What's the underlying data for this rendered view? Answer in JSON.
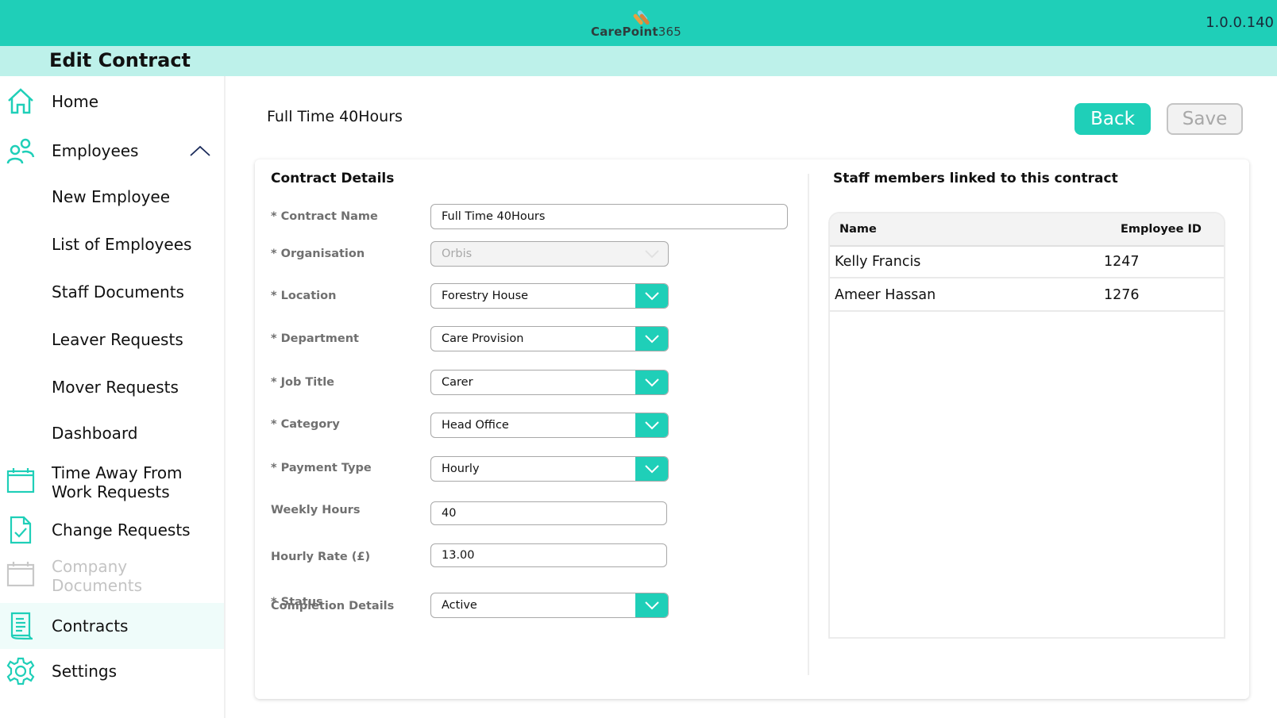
{
  "app": {
    "logo_text_bold": "CarePoint",
    "logo_text_num": "365",
    "version": "1.0.0.140",
    "page_title": "Edit Contract",
    "brand_color": "#1fcfb8"
  },
  "sidebar": {
    "items": [
      {
        "label": "Home",
        "icon": "home-icon"
      },
      {
        "label": "Employees",
        "icon": "users-icon",
        "expanded": true
      },
      {
        "label": "New Employee"
      },
      {
        "label": "List of Employees"
      },
      {
        "label": "Staff Documents"
      },
      {
        "label": "Leaver Requests"
      },
      {
        "label": "Mover Requests"
      },
      {
        "label": "Dashboard"
      },
      {
        "label": "Time Away From",
        "label2": "Work Requests",
        "icon": "calendar-icon"
      },
      {
        "label": "Change Requests",
        "icon": "document-check-icon"
      },
      {
        "label": "Company",
        "label2": "Documents",
        "icon": "calendar-icon",
        "disabled": true
      },
      {
        "label": "Contracts",
        "icon": "contract-icon",
        "active": true
      },
      {
        "label": "Settings",
        "icon": "gear-icon"
      }
    ]
  },
  "header": {
    "contract_title": "Full Time 40Hours",
    "back_label": "Back",
    "save_label": "Save"
  },
  "contract_details": {
    "title": "Contract Details",
    "fields": {
      "contract_name": {
        "label": "* Contract Name",
        "value": "Full Time 40Hours"
      },
      "organisation": {
        "label": "* Organisation",
        "value": "Orbis"
      },
      "location": {
        "label": "* Location",
        "value": "Forestry House"
      },
      "department": {
        "label": "* Department",
        "value": "Care Provision"
      },
      "job_title": {
        "label": "* Job Title",
        "value": "Carer"
      },
      "category": {
        "label": "* Category",
        "value": "Head Office"
      },
      "payment_type": {
        "label": "* Payment Type",
        "value": "Hourly"
      },
      "weekly_hours": {
        "label": "Weekly Hours",
        "value": "40"
      },
      "hourly_rate": {
        "label": "Hourly Rate (£)",
        "value": "13.00"
      },
      "status": {
        "label": "* Status",
        "label_overlap": "Completion Details",
        "value": "Active"
      }
    }
  },
  "staff": {
    "title": "Staff members linked to this contract",
    "columns": [
      "Name",
      "Employee ID"
    ],
    "rows": [
      {
        "name": "Kelly Francis",
        "id": "1247"
      },
      {
        "name": "Ameer Hassan",
        "id": "1276"
      }
    ]
  }
}
